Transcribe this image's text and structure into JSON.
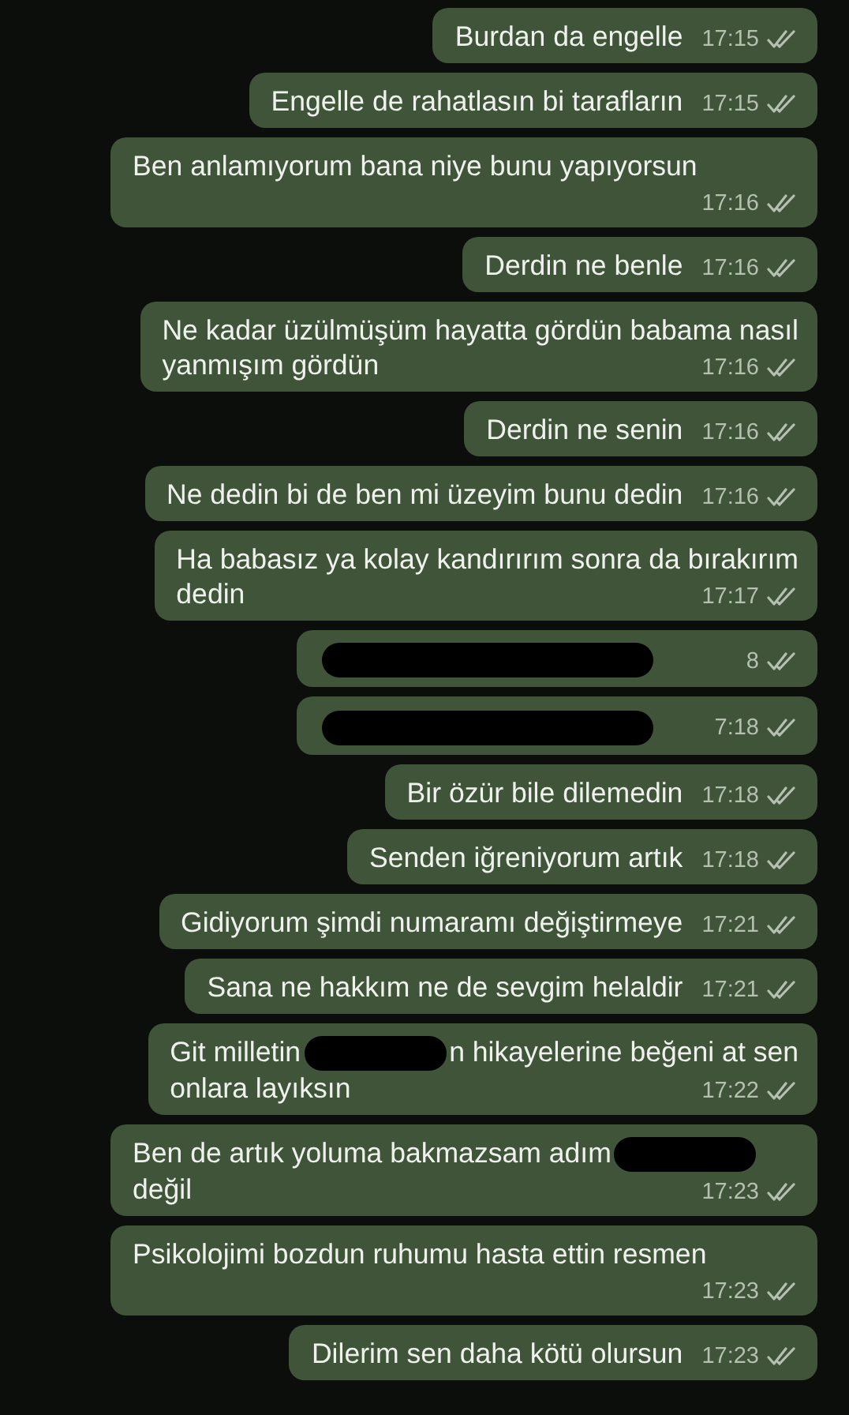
{
  "messages": [
    {
      "lines": [
        [
          {
            "kind": "text",
            "text": "Burdan da engelle"
          }
        ]
      ],
      "time": "17:15"
    },
    {
      "lines": [
        [
          {
            "kind": "text",
            "text": "Engelle de rahatlasın bi tarafların"
          }
        ]
      ],
      "time": "17:15"
    },
    {
      "lines": [
        [
          {
            "kind": "text",
            "text": "Ben anlamıyorum bana niye bunu yapıyorsun"
          }
        ]
      ],
      "time": "17:16"
    },
    {
      "lines": [
        [
          {
            "kind": "text",
            "text": "Derdin ne benle"
          }
        ]
      ],
      "time": "17:16"
    },
    {
      "lines": [
        [
          {
            "kind": "text",
            "text": "Ne kadar üzülmüşüm hayatta gördün babama nasıl"
          }
        ],
        [
          {
            "kind": "text",
            "text": "yanmışım gördün"
          }
        ]
      ],
      "time": "17:16"
    },
    {
      "lines": [
        [
          {
            "kind": "text",
            "text": "Derdin ne senin"
          }
        ]
      ],
      "time": "17:16"
    },
    {
      "lines": [
        [
          {
            "kind": "text",
            "text": "Ne dedin bi de ben mi üzeyim bunu dedin"
          }
        ]
      ],
      "time": "17:16"
    },
    {
      "lines": [
        [
          {
            "kind": "text",
            "text": "Ha babasız ya kolay kandırırım sonra da bırakırım"
          }
        ],
        [
          {
            "kind": "text",
            "text": "dedin"
          }
        ]
      ],
      "time": "17:17"
    },
    {
      "lines": [
        [
          {
            "kind": "redaction"
          }
        ]
      ],
      "time": "8"
    },
    {
      "lines": [
        [
          {
            "kind": "redaction"
          }
        ]
      ],
      "time": "7:18"
    },
    {
      "lines": [
        [
          {
            "kind": "text",
            "text": "Bir özür bile dilemedin"
          }
        ]
      ],
      "time": "17:18"
    },
    {
      "lines": [
        [
          {
            "kind": "text",
            "text": "Senden iğreniyorum artık"
          }
        ]
      ],
      "time": "17:18"
    },
    {
      "lines": [
        [
          {
            "kind": "text",
            "text": "Gidiyorum şimdi numaramı değiştirmeye"
          }
        ]
      ],
      "time": "17:21"
    },
    {
      "lines": [
        [
          {
            "kind": "text",
            "text": "Sana ne hakkım ne de sevgim helaldir"
          }
        ]
      ],
      "time": "17:21"
    },
    {
      "lines": [
        [
          {
            "kind": "text",
            "text": "Git milletin"
          },
          {
            "kind": "redaction"
          },
          {
            "kind": "text",
            "text": "n hikayelerine beğeni at sen"
          }
        ],
        [
          {
            "kind": "text",
            "text": "onlara layıksın"
          }
        ]
      ],
      "time": "17:22"
    },
    {
      "lines": [
        [
          {
            "kind": "text",
            "text": "Ben de artık yoluma bakmazsam adım"
          },
          {
            "kind": "redaction"
          },
          {
            "kind": "text",
            "text": "değil"
          }
        ]
      ],
      "time": "17:23"
    },
    {
      "lines": [
        [
          {
            "kind": "text",
            "text": "Psikolojimi bozdun ruhumu hasta ettin resmen"
          }
        ]
      ],
      "time": "17:23"
    },
    {
      "lines": [
        [
          {
            "kind": "text",
            "text": "Dilerim sen daha kötü olursun"
          }
        ]
      ],
      "time": "17:23"
    }
  ]
}
